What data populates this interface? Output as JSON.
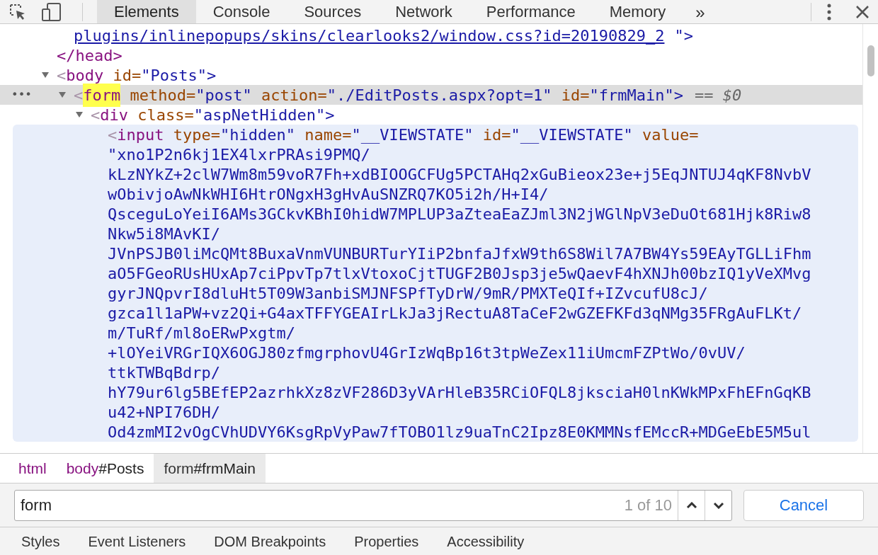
{
  "toolbar": {
    "tabs": [
      {
        "label": "Elements",
        "selected": true
      },
      {
        "label": "Console",
        "selected": false
      },
      {
        "label": "Sources",
        "selected": false
      },
      {
        "label": "Network",
        "selected": false
      },
      {
        "label": "Performance",
        "selected": false
      },
      {
        "label": "Memory",
        "selected": false
      }
    ],
    "more": "»"
  },
  "tree": [
    {
      "kind": "link_tail",
      "text": "plugins/inlinepopups/skins/clearlooks2/window.css?id=20190829_2",
      "close": "\">"
    },
    {
      "kind": "close_tag",
      "text": "</head>"
    },
    {
      "kind": "element",
      "open": "<",
      "tag": "body",
      "rest": " id=\"Posts\">",
      "expanded": true,
      "selected": false,
      "children": [
        {
          "kind": "element",
          "gutter": "•••",
          "open": "<",
          "tag": "form",
          "match": true,
          "rest": " method=\"post\" action=\"./EditPosts.aspx?opt=1\" id=\"frmMain\">",
          "expanded": true,
          "selected": true,
          "marker": "== $0",
          "children": [
            {
              "kind": "element",
              "open": "<",
              "tag": "div",
              "rest": " class=\"aspNetHidden\">",
              "expanded": true,
              "selected": false,
              "children": [
                {
                  "kind": "element",
                  "open": "<",
                  "tag": "input",
                  "hovered": true,
                  "rest": " type=\"hidden\" name=\"__VIEWSTATE\" id=\"__VIEWSTATE\" value=",
                  "value_lines": [
                    "\"xno1P2n6kj1EX4lxrPRAsi9PMQ/",
                    "kLzNYkZ+2clW7Wm8m59voR7Fh+xdBIOOGCFUg5PCTAHq2xGuBieox23e+j5EqJNTUJ4qKF8NvbV",
                    "wObivjoAwNkWHI6HtrONgxH3gHvAuSNZRQ7KO5i2h/H+I4/",
                    "QsceguLoYeiI6AMs3GCkvKBhI0hidW7MPLUP3aZteaEaZJml3N2jWGlNpV3eDuOt681Hjk8Riw8",
                    "Nkw5i8MAvKI/",
                    "JVnPSJB0liMcQMt8BuxaVnmVUNBURTurYIiP2bnfaJfxW9th6S8Wil7A7BW4Ys59EAyTGLLiFhm",
                    "aO5FGeoRUsHUxAp7ciPpvTp7tlxVtoxoCjtTUGF2B0Jsp3je5wQaevF4hXNJh00bzIQ1yVeXMvg",
                    "gyrJNQpvrI8dluHt5T09W3anbiSMJNFSPfTyDrW/9mR/PMXTeQIf+IZvcufU8cJ/",
                    "gzca1l1aPW+vz2Qi+G4axTFFYGEAIrLkJa3jRectuA8TaCeF2wGZEFKFd3qNMg35FRgAuFLKt/",
                    "m/TuRf/ml8oERwPxgtm/",
                    "+lOYeiVRGrIQX6OGJ80zfmgrphovU4GrIzWqBp16t3tpWeZex11iUmcmFZPtWo/0vUV/",
                    "ttkTWBqBdrp/",
                    "hY79ur6lg5BEfEP2azrhkXz8zVF286D3yVArHleB35RCiOFQL8jksciaH0lnKWkMPxFhEFnGqKB",
                    "u42+NPI76DH/",
                    "Od4zmMI2vOgCVhUDVY6KsgRpVyPaw7fTOBO1lz9uaTnC2Ipz8E0KMMNsfEMccR+MDGeEbE5M5ul"
                  ]
                }
              ]
            }
          ]
        }
      ]
    }
  ],
  "breadcrumbs": [
    {
      "tag": "html",
      "selected": false
    },
    {
      "tag": "body",
      "id": "#Posts",
      "selected": false
    },
    {
      "tag": "form",
      "id": "#frmMain",
      "selected": true
    }
  ],
  "search": {
    "value": "form",
    "count": "1 of 10",
    "cancel": "Cancel"
  },
  "bottom_tabs": [
    {
      "label": "Styles"
    },
    {
      "label": "Event Listeners"
    },
    {
      "label": "DOM Breakpoints"
    },
    {
      "label": "Properties"
    },
    {
      "label": "Accessibility"
    }
  ]
}
